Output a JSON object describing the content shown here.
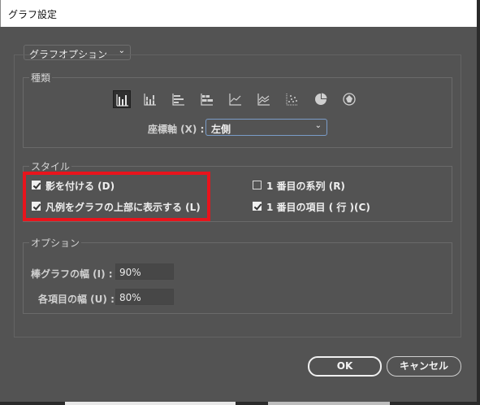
{
  "window": {
    "title": "グラフ設定"
  },
  "section_dropdown": {
    "value": "グラフオプション"
  },
  "type_group": {
    "label": "種類",
    "icons": [
      {
        "name": "vertical-bar-chart-icon",
        "selected": true
      },
      {
        "name": "stacked-vertical-bar-chart-icon",
        "selected": false
      },
      {
        "name": "horizontal-bar-chart-icon",
        "selected": false
      },
      {
        "name": "stacked-horizontal-bar-chart-icon",
        "selected": false
      },
      {
        "name": "line-chart-icon",
        "selected": false
      },
      {
        "name": "area-chart-icon",
        "selected": false
      },
      {
        "name": "scatter-chart-icon",
        "selected": false
      },
      {
        "name": "pie-chart-icon",
        "selected": false
      },
      {
        "name": "radar-chart-icon",
        "selected": false
      }
    ],
    "axis_label": "座標軸 (X) :",
    "axis_value": "左側"
  },
  "style_group": {
    "label": "スタイル",
    "shadow": {
      "label": "影を付ける (D)",
      "checked": true
    },
    "legend_top": {
      "label": "凡例をグラフの上部に表示する (L)",
      "checked": true
    },
    "first_series": {
      "label": "1 番目の系列 (R)",
      "checked": false
    },
    "first_item": {
      "label": "1 番目の項目 ( 行 )(C)",
      "checked": true
    },
    "highlight_color": "#e8141c"
  },
  "options_group": {
    "label": "オプション",
    "bar_width_label": "棒グラフの幅 (I) :",
    "bar_width_value": "90%",
    "item_width_label": "各項目の幅 (U) :",
    "item_width_value": "80%"
  },
  "buttons": {
    "ok": "OK",
    "cancel": "キャンセル"
  }
}
